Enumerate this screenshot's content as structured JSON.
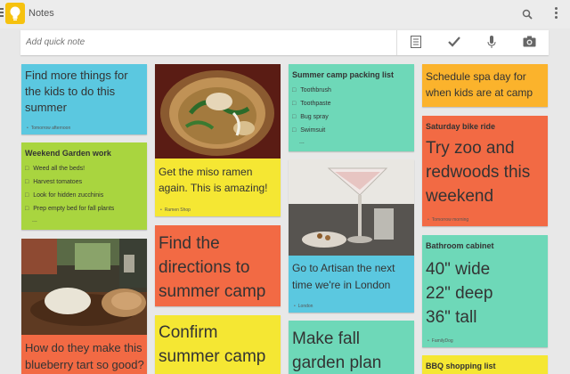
{
  "app": {
    "title": "Notes"
  },
  "quick_note": {
    "placeholder": "Add quick note"
  },
  "colors": {
    "blue": "#5bc8e0",
    "green": "#a9d53f",
    "orange": "#f26a44",
    "yellow": "#f5e733",
    "teal": "#6ed8b8",
    "amber": "#fbb32c"
  },
  "notes": {
    "kids": {
      "text": "Find more things for the kids to do this summer",
      "location": "Tomorrow afternoon"
    },
    "garden": {
      "title": "Weekend Garden work",
      "items": [
        "Weed all the beds!",
        "Harvest tomatoes",
        "Look for hidden zucchinis",
        "Prep empty bed for fall plants"
      ],
      "more": "..."
    },
    "tart": {
      "text": "How do they make this blueberry tart so good?"
    },
    "ramen": {
      "text": "Get the miso ramen again. This is amazing!",
      "location": "Ramen Shop"
    },
    "directions": {
      "text": "Find the directions to summer camp"
    },
    "confirm": {
      "text": "Confirm summer camp"
    },
    "packing": {
      "title": "Summer camp packing list",
      "items": [
        "Toothbrush",
        "Toothpaste",
        "Bug spray",
        "Swimsuit"
      ],
      "more": "..."
    },
    "artisan": {
      "text": "Go to Artisan the next time we're in London",
      "location": "London"
    },
    "fall": {
      "text": "Make fall garden plan"
    },
    "spa": {
      "text": "Schedule spa day for when kids are at camp"
    },
    "bike": {
      "title": "Saturday bike ride",
      "text": "Try zoo and redwoods this weekend",
      "footer": "Tomorrow morning"
    },
    "cabinet": {
      "title": "Bathroom cabinet",
      "lines": [
        "40\" wide",
        "22\" deep",
        "36\" tall"
      ],
      "location": "FamilyDog"
    },
    "bbq": {
      "title": "BBQ shopping list"
    }
  }
}
